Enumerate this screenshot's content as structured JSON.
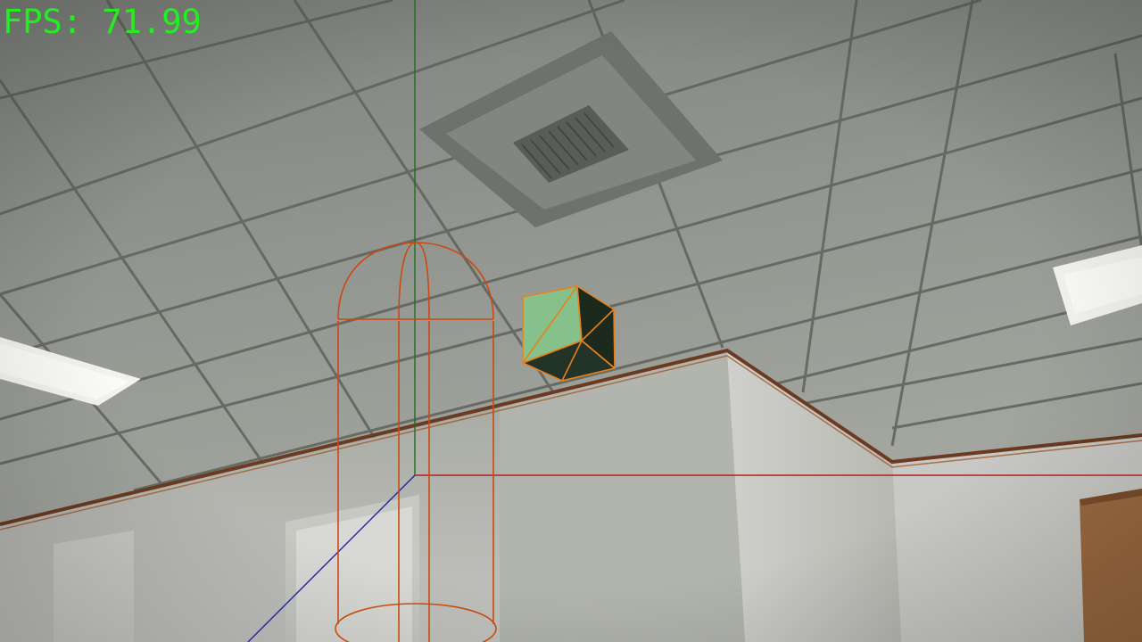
{
  "hud": {
    "fps_text": "FPS: 71.99",
    "fps_color": "#22ee22"
  },
  "scene": {
    "environment": "office-ceiling",
    "objects": [
      {
        "name": "capsule-collider-wireframe",
        "kind": "capsule",
        "color": "#c84a10"
      },
      {
        "name": "cube",
        "kind": "box",
        "face_color": "#86c08a",
        "edge_color": "#e8801c"
      },
      {
        "name": "axis-x-line",
        "color": "#b41e1e"
      },
      {
        "name": "axis-y-line",
        "color": "#1e6e1e"
      },
      {
        "name": "axis-z-line",
        "color": "#2222aa"
      }
    ],
    "colors": {
      "ceiling": "#8e918b",
      "grid": "#5e6159",
      "wall": "#b8bab4",
      "trim": "#6b3a20",
      "light_panel": "#f2f2ee",
      "door": "#9a6a40"
    }
  }
}
